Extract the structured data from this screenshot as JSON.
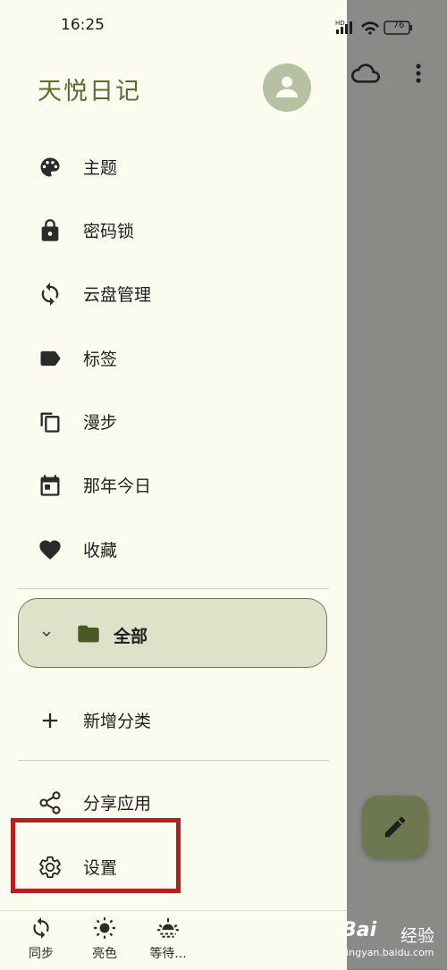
{
  "status_bar": {
    "time": "16:25",
    "battery": "76"
  },
  "app": {
    "title": "天悦日记"
  },
  "menu": {
    "items": [
      {
        "label": "主题",
        "icon": "palette-icon"
      },
      {
        "label": "密码锁",
        "icon": "lock-icon"
      },
      {
        "label": "云盘管理",
        "icon": "sync-icon"
      },
      {
        "label": "标签",
        "icon": "label-icon"
      },
      {
        "label": "漫步",
        "icon": "copy-icon"
      },
      {
        "label": "那年今日",
        "icon": "calendar-icon"
      },
      {
        "label": "收藏",
        "icon": "heart-icon"
      }
    ],
    "folder": {
      "label": "全部"
    },
    "add_category": "新增分类",
    "share": "分享应用",
    "settings": "设置"
  },
  "bottom_bar": {
    "sync": "同步",
    "light": "亮色",
    "wait": "等待..."
  },
  "watermark": {
    "main": "Bai",
    "sub": "经验",
    "url": "jingyan.baidu.com"
  },
  "colors": {
    "accent": "#5c6b2e",
    "drawer_bg": "#fbfbf0",
    "highlight": "#b5201d",
    "fab": "#6d7850"
  }
}
